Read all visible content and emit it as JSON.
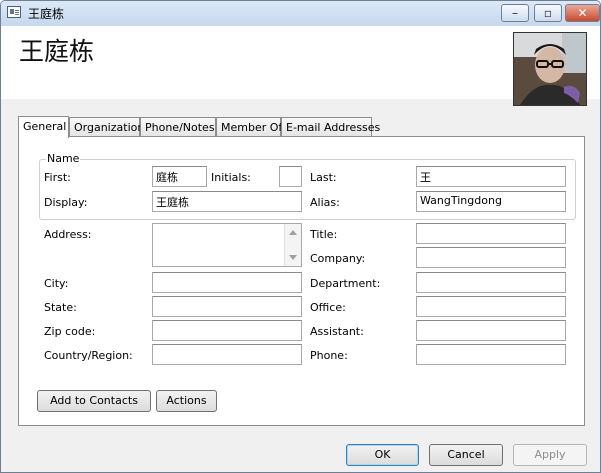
{
  "window": {
    "title": "王庭栋",
    "buttons": {
      "minimize": "–",
      "maximize": "▫",
      "close": "✕"
    }
  },
  "header": {
    "display_name": "王庭栋"
  },
  "tabs": [
    {
      "label": "General",
      "active": true
    },
    {
      "label": "Organization",
      "active": false
    },
    {
      "label": "Phone/Notes",
      "active": false
    },
    {
      "label": "Member Of",
      "active": false
    },
    {
      "label": "E-mail Addresses",
      "active": false
    }
  ],
  "name_group": {
    "label": "Name",
    "first_label": "First:",
    "first_value": "庭栋",
    "initials_label": "Initials:",
    "initials_value": "",
    "last_label": "Last:",
    "last_value": "王",
    "display_label": "Display:",
    "display_value": "王庭栋",
    "alias_label": "Alias:",
    "alias_value": "WangTingdong"
  },
  "address": {
    "address_label": "Address:",
    "address_value": "",
    "city_label": "City:",
    "city_value": "",
    "state_label": "State:",
    "state_value": "",
    "zip_label": "Zip code:",
    "zip_value": "",
    "country_label": "Country/Region:",
    "country_value": ""
  },
  "work": {
    "title_label": "Title:",
    "title_value": "",
    "company_label": "Company:",
    "company_value": "",
    "department_label": "Department:",
    "department_value": "",
    "office_label": "Office:",
    "office_value": "",
    "assistant_label": "Assistant:",
    "assistant_value": "",
    "phone_label": "Phone:",
    "phone_value": ""
  },
  "panel_buttons": {
    "add_to_contacts": "Add to Contacts",
    "actions": "Actions"
  },
  "dialog_buttons": {
    "ok": "OK",
    "cancel": "Cancel",
    "apply": "Apply"
  }
}
